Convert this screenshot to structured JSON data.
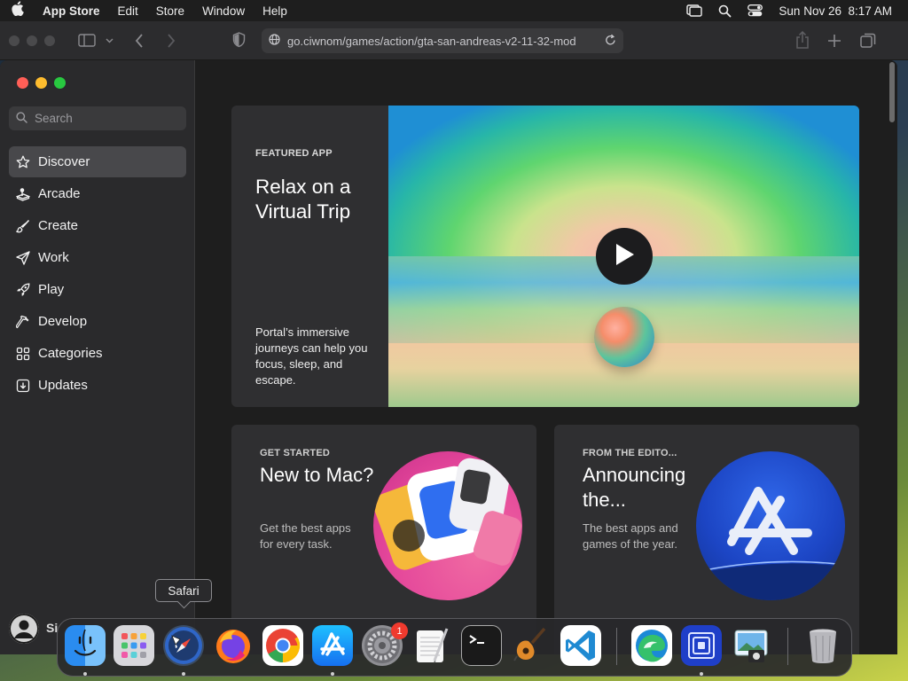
{
  "menubar": {
    "app_name": "App Store",
    "items": [
      "Edit",
      "Store",
      "Window",
      "Help"
    ],
    "datetime": "Sun Nov 26  8:17 AM"
  },
  "browser": {
    "url": "go.ciwnom/games/action/gta-san-andreas-v2-11-32-mod"
  },
  "sidebar": {
    "search_placeholder": "Search",
    "items": [
      {
        "label": "Discover",
        "icon": "star-icon",
        "active": true
      },
      {
        "label": "Arcade",
        "icon": "joystick-icon",
        "active": false
      },
      {
        "label": "Create",
        "icon": "brush-icon",
        "active": false
      },
      {
        "label": "Work",
        "icon": "paper-plane-icon",
        "active": false
      },
      {
        "label": "Play",
        "icon": "rocket-icon",
        "active": false
      },
      {
        "label": "Develop",
        "icon": "hammer-icon",
        "active": false
      },
      {
        "label": "Categories",
        "icon": "grid-icon",
        "active": false
      },
      {
        "label": "Updates",
        "icon": "download-icon",
        "active": false
      }
    ],
    "account_initials": "Si"
  },
  "featured": {
    "eyebrow": "FEATURED APP",
    "title": "Relax on a Virtual Trip",
    "description": "Portal’s immersive journeys can help you focus, sleep, and escape."
  },
  "cards": {
    "started": {
      "eyebrow": "GET STARTED",
      "title": "New to Mac?",
      "description": "Get the best apps for every task."
    },
    "editors": {
      "eyebrow": "FROM THE EDITO...",
      "title": "Announcing the...",
      "description": "The best apps and games of the year."
    }
  },
  "tooltip": "Safari",
  "dock": {
    "settings_badge": "1",
    "apps": [
      "Finder",
      "Launchpad",
      "Safari",
      "Firefox",
      "Chrome",
      "App Store",
      "System Settings",
      "TextEdit",
      "Terminal",
      "GarageBand",
      "VS Code",
      "Edge",
      "Screen Sharing",
      "Preview",
      "Trash"
    ]
  },
  "colors": {
    "traffic_red": "#ff5f57",
    "traffic_yellow": "#febc2e",
    "traffic_green": "#28c840",
    "sidebar_active": "#48484b"
  }
}
